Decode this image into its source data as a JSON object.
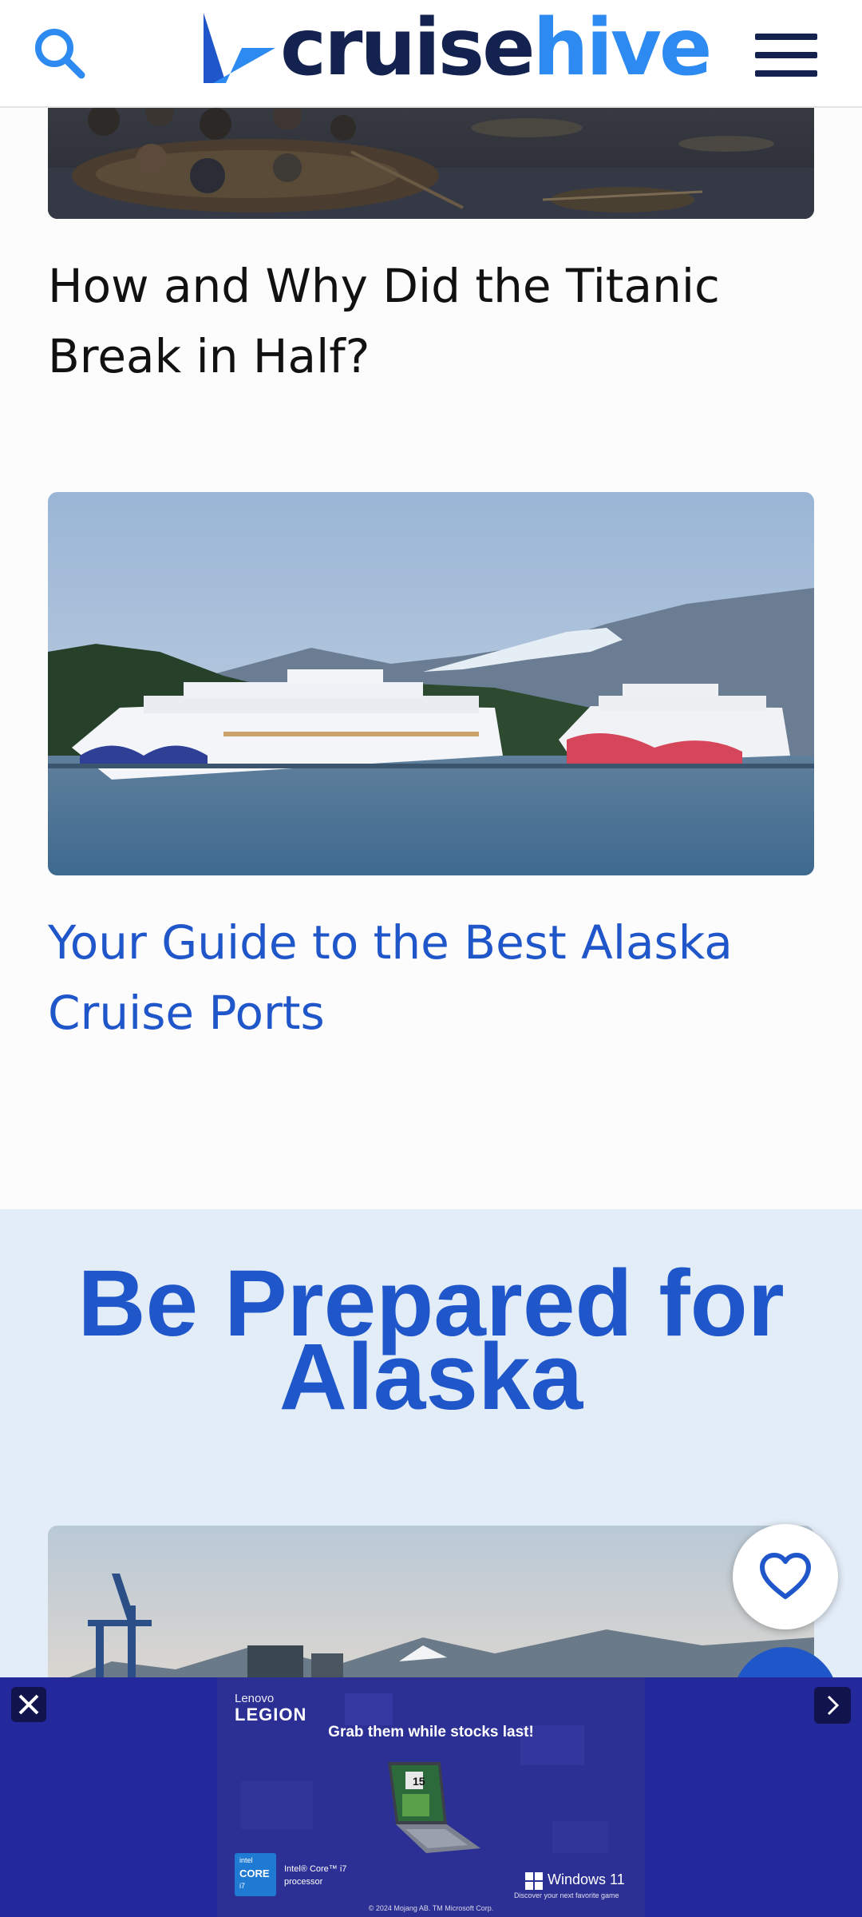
{
  "header": {
    "logo_part1": "cruise",
    "logo_part2": "hive",
    "search_icon": "search-icon",
    "menu_icon": "hamburger-menu-icon"
  },
  "articles": [
    {
      "title": "How and Why Did the Titanic Break in Half?",
      "image": "titanic-lifeboats-painting"
    },
    {
      "title": "Your Guide to the Best Alaska Cruise Ports",
      "image": "cruise-ships-alaska-port"
    }
  ],
  "section": {
    "title": "Be Prepared for Alaska",
    "image": "alaska-port-cranes"
  },
  "floating": {
    "favorite_icon": "heart-icon"
  },
  "ad": {
    "brand_top": "Lenovo",
    "brand_main": "LEGION",
    "headline": "Grab them while stocks last!",
    "intel_small": "intel",
    "intel_core": "CORE",
    "intel_tier": "i7",
    "intel_line1": "Intel® Core™ i7",
    "intel_line2": "processor",
    "windows_label": "Windows 11",
    "windows_tagline": "Discover your next favorite game",
    "legal": "© 2024 Mojang AB. TM Microsoft Corp.",
    "screen_badge": "15"
  },
  "colors": {
    "brand_navy": "#14224f",
    "brand_blue": "#2d8af0",
    "link_blue": "#1f56c9",
    "band_bg": "#e3edf8",
    "ad_bg": "#23289a"
  }
}
